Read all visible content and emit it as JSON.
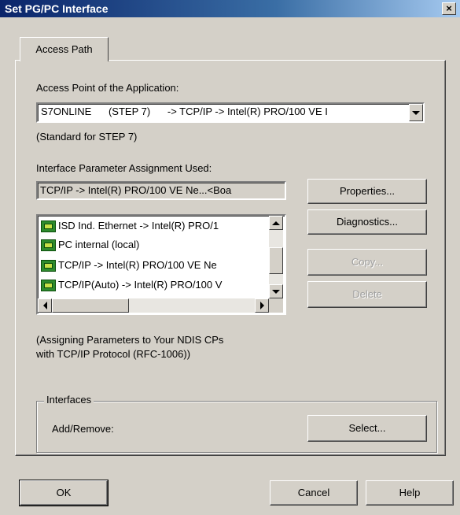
{
  "window": {
    "title": "Set PG/PC Interface",
    "close_label": "×"
  },
  "tabs": [
    {
      "label": "Access Path",
      "selected": true
    }
  ],
  "access_point": {
    "label": "Access Point of the Application:",
    "value": "S7ONLINE      (STEP 7)      -> TCP/IP -> Intel(R) PRO/100 VE I",
    "note": "(Standard for STEP 7)"
  },
  "interface_assignment": {
    "label": "Interface Parameter Assignment Used:",
    "current_value": "TCP/IP -> Intel(R) PRO/100 VE Ne...<Boa",
    "list_items": [
      {
        "label": "ISD Ind. Ethernet -> Intel(R) PRO/1",
        "icon": "network-adapter-icon"
      },
      {
        "label": "PC internal (local)",
        "icon": "network-adapter-icon"
      },
      {
        "label": "TCP/IP -> Intel(R) PRO/100 VE Ne",
        "icon": "network-adapter-icon"
      },
      {
        "label": "TCP/IP(Auto) -> Intel(R) PRO/100 V",
        "icon": "network-adapter-icon"
      }
    ],
    "description_line1": "(Assigning Parameters to Your NDIS CPs",
    "description_line2": "with TCP/IP Protocol (RFC-1006))"
  },
  "side_buttons": {
    "properties": "Properties...",
    "diagnostics": "Diagnostics...",
    "copy": "Copy...",
    "delete": "Delete"
  },
  "interfaces_group": {
    "legend": "Interfaces",
    "add_remove_label": "Add/Remove:",
    "select_button": "Select..."
  },
  "footer": {
    "ok": "OK",
    "cancel": "Cancel",
    "help": "Help"
  },
  "colors": {
    "dialog_face": "#d4d0c8",
    "title_gradient_start": "#0a246a",
    "title_gradient_end": "#a6caf0",
    "disabled_text": "#a0a0a0"
  }
}
